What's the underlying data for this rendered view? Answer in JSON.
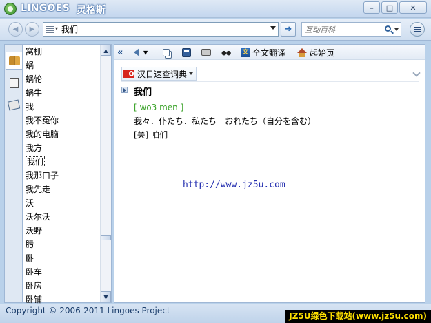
{
  "title_bar": {
    "brand": "LINGOES",
    "brand_cn": "灵格斯",
    "buttons": {
      "minimize": "–",
      "maximize": "□",
      "close": "✕"
    }
  },
  "toolbar": {
    "search_value": "我们",
    "wiki_placeholder": "互动百科"
  },
  "word_list": {
    "items": [
      "窝棚",
      "蜗",
      "蜗轮",
      "蜗牛",
      "我",
      "我不冤你",
      "我的电脑",
      "我方",
      "我们",
      "我那口子",
      "我先走",
      "沃",
      "沃尔沃",
      "沃野",
      "肟",
      "卧",
      "卧车",
      "卧房",
      "卧铺"
    ],
    "selected_index": 8
  },
  "result_toolbar": {
    "collapse": "«",
    "full_translate_label": "全文翻译",
    "home_label": "起始页"
  },
  "dictionary": {
    "name": "汉日速查词典",
    "headword": "我们",
    "pinyin": "[ wo3 men ]",
    "meaning": "我々．仆たち．私たち　おれたち（自分を含む）",
    "related": "[关] 咱们"
  },
  "watermark_url": "http://www.jz5u.com",
  "status": {
    "copyright": "Copyright © 2006-2011 Lingoes Project",
    "badge": "JZ5U绿色下载站(www.jz5u.com)"
  },
  "colors": {
    "accent": "#2e6db5",
    "pinyin": "#3ca32b",
    "watermark": "#2530b0",
    "badge_text": "#ffe100"
  }
}
